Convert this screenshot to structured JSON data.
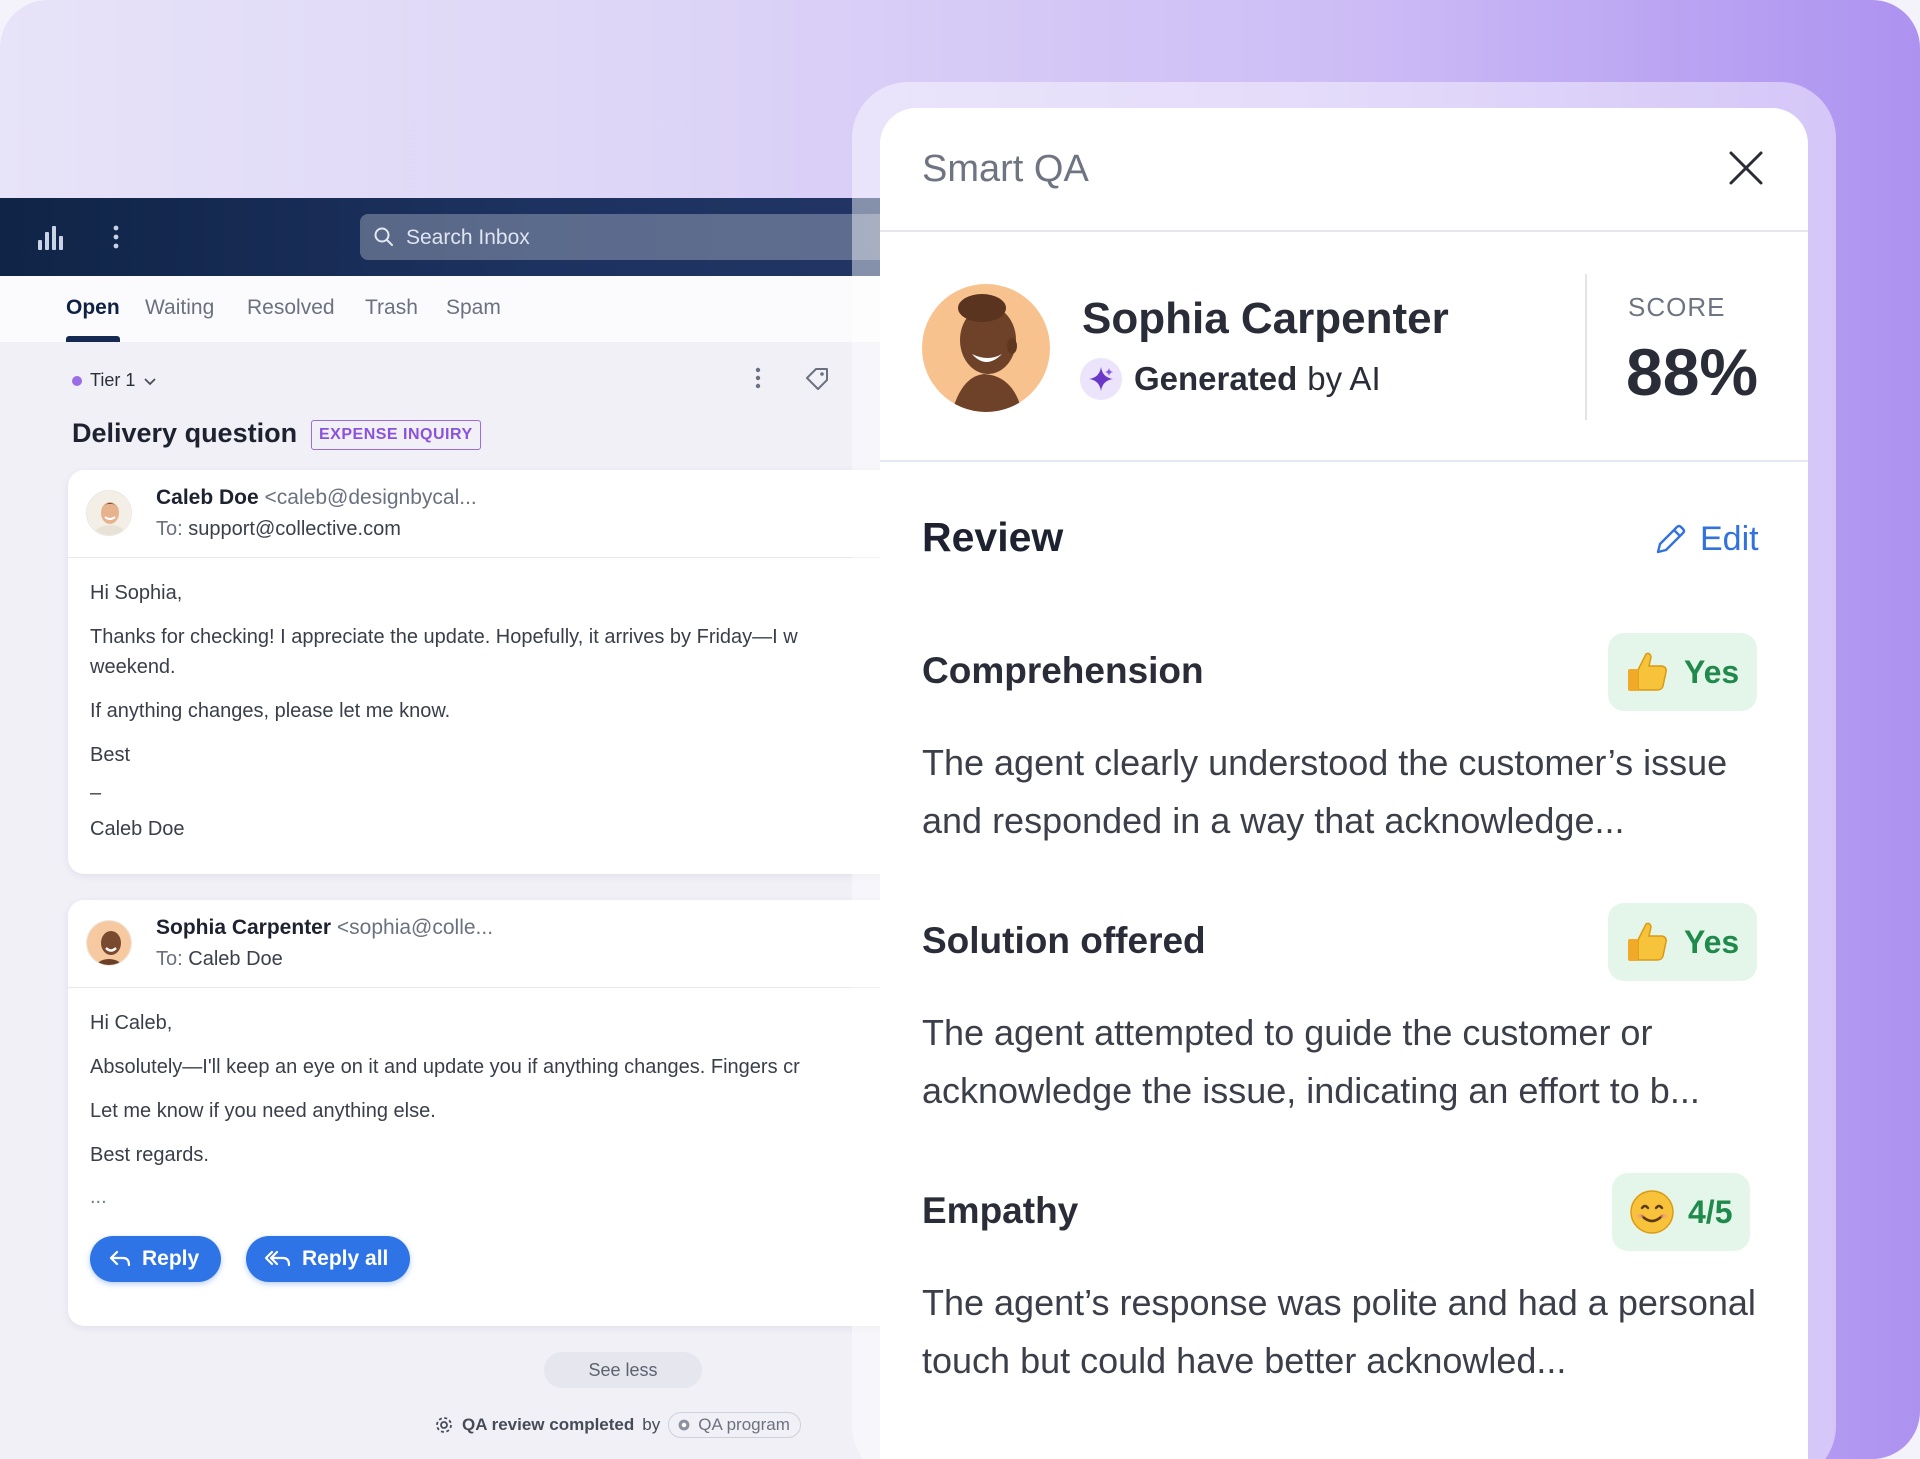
{
  "inbox": {
    "search_placeholder": "Search Inbox",
    "tabs": [
      "Open",
      "Waiting",
      "Resolved",
      "Trash",
      "Spam"
    ],
    "active_tab": "Open",
    "tier_label": "Tier 1",
    "subject": "Delivery question",
    "subject_badge": "EXPENSE INQUIRY",
    "messages": [
      {
        "sender_name": "Caleb Doe",
        "sender_email": "<caleb@designbycal...",
        "to_label": "To:",
        "to": "support@collective.com",
        "lines": [
          "Hi Sophia,",
          "Thanks for checking! I appreciate the update. Hopefully, it arrives by Friday—I w",
          "weekend.",
          "If anything changes, please let me know.",
          "Best",
          "–",
          "Caleb Doe"
        ]
      },
      {
        "sender_name": "Sophia Carpenter",
        "sender_email": "<sophia@colle...",
        "to_label": "To:",
        "to": "Caleb Doe",
        "lines": [
          "Hi Caleb,",
          "Absolutely—I'll keep an eye on it and update you if anything changes. Fingers cr",
          "Let me know if you need anything else.",
          "Best regards.",
          "..."
        ],
        "reply_label": "Reply",
        "reply_all_label": "Reply all"
      }
    ],
    "see_less": "See less",
    "qa_completed": "QA review completed",
    "qa_by": "by",
    "qa_program": "QA program"
  },
  "panel": {
    "title": "Smart QA",
    "agent_name": "Sophia Carpenter",
    "generated_prefix": "Generated",
    "generated_suffix": "by AI",
    "score_label": "SCORE",
    "score_value": "88%",
    "review_heading": "Review",
    "edit_label": "Edit",
    "criteria": [
      {
        "name": "Comprehension",
        "rating": "Yes",
        "rating_icon": "thumbs-up-icon",
        "text": "The agent clearly understood the customer’s issue and responded in a way that acknowledge..."
      },
      {
        "name": "Solution offered",
        "rating": "Yes",
        "rating_icon": "thumbs-up-icon",
        "text": "The agent attempted to guide the customer or acknowledge the issue, indicating an effort to b..."
      },
      {
        "name": "Empathy",
        "rating": "4/5",
        "rating_icon": "smiley-icon",
        "text": "The agent’s response was polite and had a personal touch but could have better acknowled..."
      }
    ]
  },
  "colors": {
    "accent_blue": "#2f74e6",
    "badge_purple": "#8b52dd",
    "rating_green": "#1f8a4b",
    "rating_bg": "#e4f6ea",
    "topbar_navy": "#102447"
  }
}
